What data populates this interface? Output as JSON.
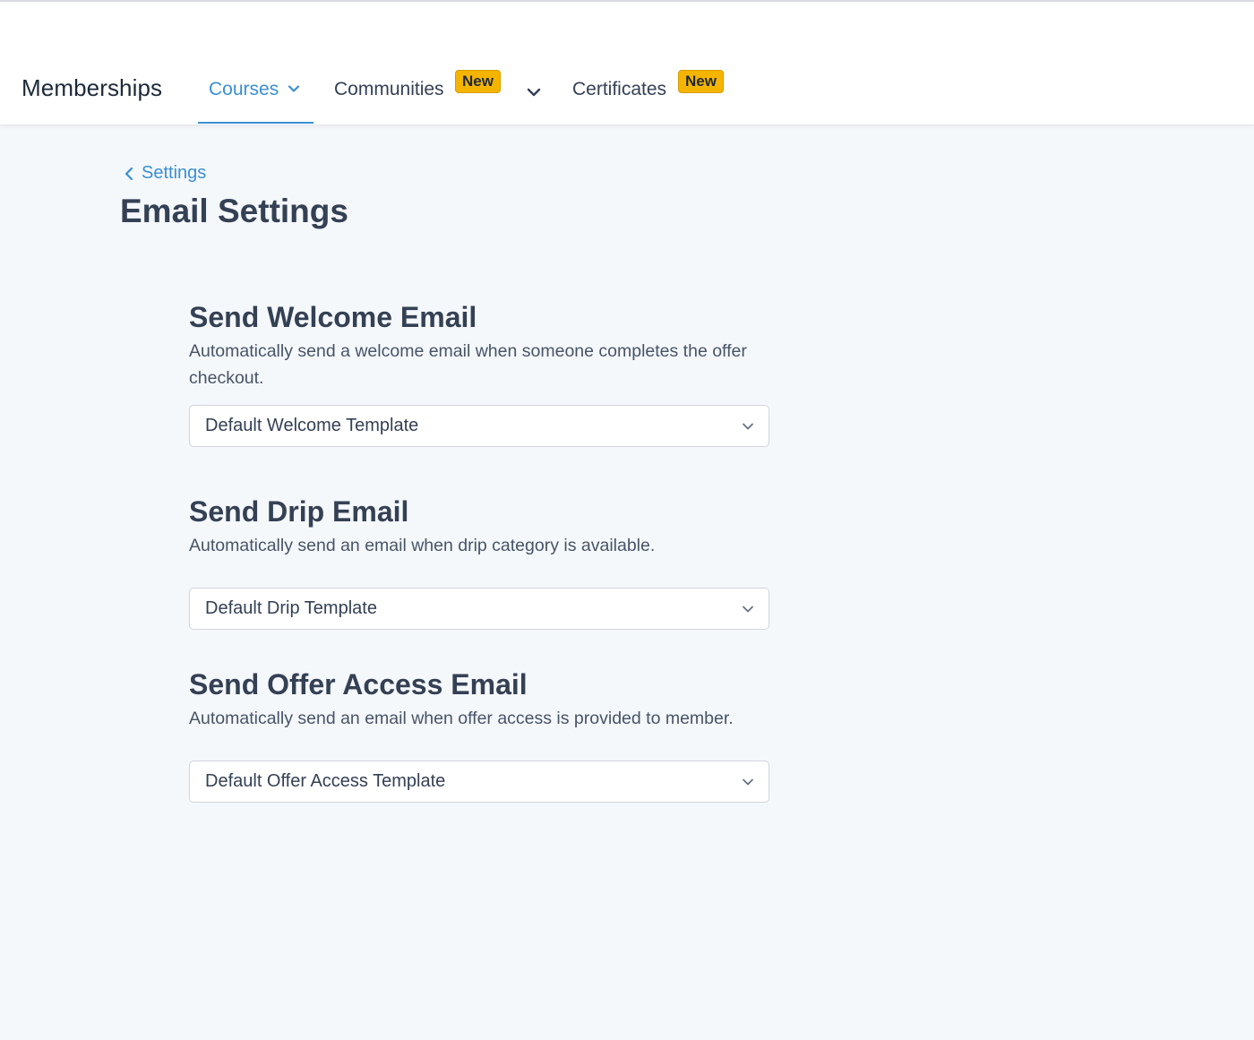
{
  "nav": {
    "brand": "Memberships",
    "tabs": [
      {
        "label": "Courses",
        "active": true
      },
      {
        "label": "Communities",
        "badge": "New"
      },
      {
        "label": "Certificates",
        "badge": "New"
      }
    ],
    "accent_color": "#3a8fd4",
    "badge_color": "#f5b400"
  },
  "breadcrumb": {
    "back_label": "Settings"
  },
  "page": {
    "title": "Email Settings"
  },
  "sections": [
    {
      "title": "Send Welcome Email",
      "description": "Automatically send a welcome email when someone completes the offer checkout.",
      "selected": "Default Welcome Template"
    },
    {
      "title": "Send Drip Email",
      "description": "Automatically send an email when drip category is available.",
      "selected": "Default Drip Template"
    },
    {
      "title": "Send Offer Access Email",
      "description": "Automatically send an email when offer access is provided to member.",
      "selected": "Default Offer Access Template"
    }
  ],
  "icons": [
    "chevron-down-icon",
    "chevron-left-icon"
  ]
}
